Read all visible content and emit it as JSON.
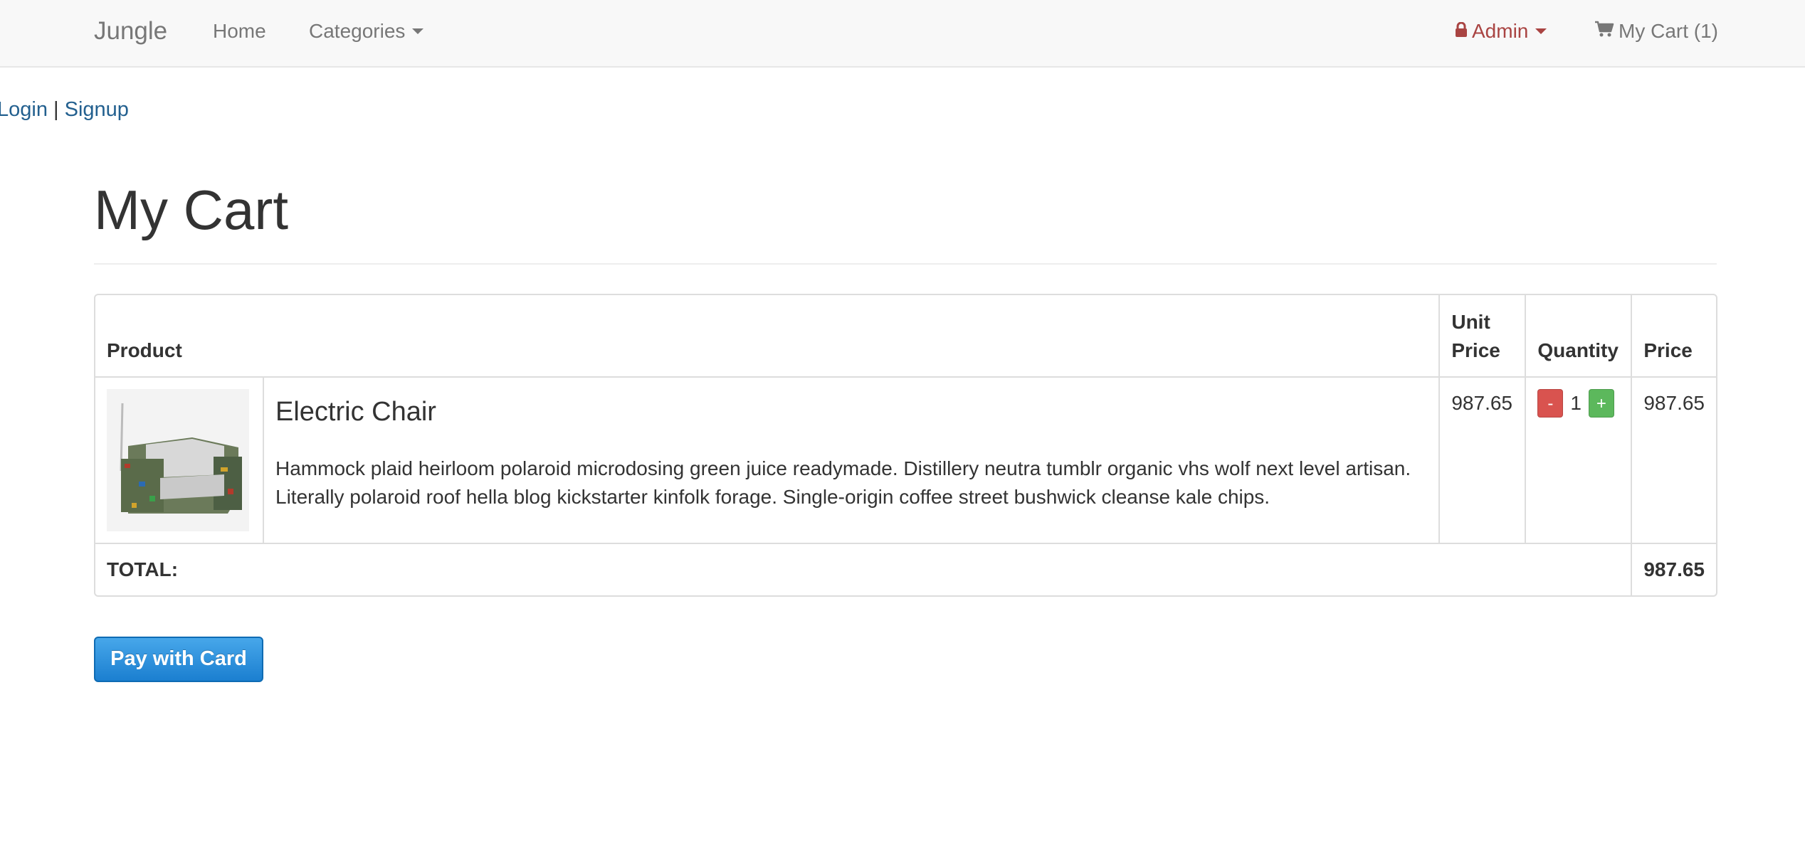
{
  "navbar": {
    "brand": "Jungle",
    "home": "Home",
    "categories": "Categories",
    "admin": "Admin",
    "cart": "My Cart (1)"
  },
  "auth": {
    "login": "Login",
    "separator": "|",
    "signup": "Signup"
  },
  "page": {
    "title": "My Cart"
  },
  "table": {
    "headers": {
      "product": "Product",
      "unit_price": "Unit Price",
      "quantity": "Quantity",
      "price": "Price"
    },
    "items": [
      {
        "name": "Electric Chair",
        "description": "Hammock plaid heirloom polaroid microdosing green juice readymade. Distillery neutra tumblr organic vhs wolf next level artisan. Literally polaroid roof hella blog kickstarter kinfolk forage. Single-origin coffee street bushwick cleanse kale chips.",
        "unit_price": "987.65",
        "quantity": "1",
        "price": "987.65",
        "minus_label": "-",
        "plus_label": "+"
      }
    ],
    "total_label": "TOTAL:",
    "total_value": "987.65"
  },
  "checkout": {
    "pay_button": "Pay with Card"
  },
  "colors": {
    "admin": "#a94442",
    "link": "#23608f",
    "minus": "#d9534f",
    "plus": "#5cb85c",
    "pay": "#1b7fd0"
  },
  "icons": {
    "admin": "lock-icon",
    "cart": "cart-icon"
  }
}
